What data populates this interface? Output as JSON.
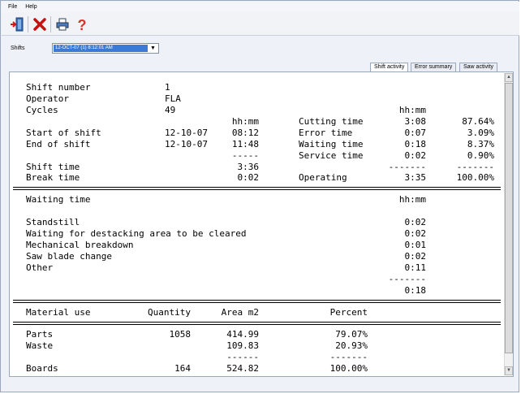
{
  "menu": {
    "file": "File",
    "help": "Help"
  },
  "toolbar": {
    "exit_icon": "exit-door-icon",
    "delete_icon": "red-x-icon",
    "print_icon": "printer-icon",
    "help_icon": "question-mark-icon"
  },
  "shifts": {
    "label": "Shifts",
    "selected": "12-OCT-07 (1)  8:12:01 AM"
  },
  "tabs": [
    {
      "label": "Shift activity"
    },
    {
      "label": "Error summary"
    },
    {
      "label": "Saw activity"
    }
  ],
  "report": {
    "shift_number_label": "Shift number",
    "shift_number": "1",
    "operator_label": "Operator",
    "operator": "FLA",
    "cycles_label": "Cycles",
    "cycles": "49",
    "hhmm": "hh:mm",
    "start_label": "Start of shift",
    "start_date": "12-10-07",
    "start_time": "08:12",
    "end_label": "End of shift",
    "end_date": "12-10-07",
    "end_time": "11:48",
    "dash5": "-----",
    "shift_time_label": "Shift time",
    "shift_time": "3:36",
    "break_time_label": "Break time",
    "break_time": "0:02",
    "times": [
      {
        "label": "Cutting time",
        "time": "3:08",
        "pct": "87.64%"
      },
      {
        "label": "Error time",
        "time": "0:07",
        "pct": "3.09%"
      },
      {
        "label": "Waiting time",
        "time": "0:18",
        "pct": "8.37%"
      },
      {
        "label": "Service time",
        "time": "0:02",
        "pct": "0.90%"
      }
    ],
    "dash7": "-------",
    "operating_label": "Operating",
    "operating_time": "3:35",
    "operating_pct": "100.00%",
    "waiting_header": "Waiting time",
    "waiting": [
      {
        "label": "Standstill",
        "time": "0:02"
      },
      {
        "label": "Waiting for destacking area to be cleared",
        "time": "0:02"
      },
      {
        "label": "Mechanical breakdown",
        "time": "0:01"
      },
      {
        "label": "Saw blade change",
        "time": "0:02"
      },
      {
        "label": "Other",
        "time": "0:11"
      }
    ],
    "waiting_total": "0:18",
    "material_header": {
      "material": "Material use",
      "quantity": "Quantity",
      "area": "Area m2",
      "percent": "Percent"
    },
    "materials": [
      {
        "name": "Parts",
        "qty": "1058",
        "area": "414.99",
        "pct": "79.07%"
      },
      {
        "name": "Waste",
        "qty": "",
        "area": "109.83",
        "pct": "20.93%"
      }
    ],
    "dash6": "------",
    "boards": {
      "name": "Boards",
      "qty": "164",
      "area": "524.82",
      "pct": "100.00%"
    }
  }
}
